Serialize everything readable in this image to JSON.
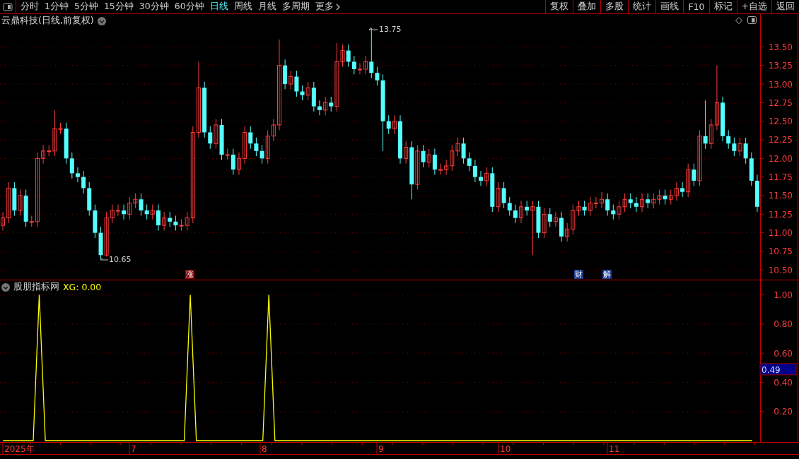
{
  "toolbar": {
    "tabs": [
      {
        "label": "分时",
        "selected": false
      },
      {
        "label": "1分钟",
        "selected": false
      },
      {
        "label": "5分钟",
        "selected": false
      },
      {
        "label": "15分钟",
        "selected": false
      },
      {
        "label": "30分钟",
        "selected": false
      },
      {
        "label": "60分钟",
        "selected": false
      },
      {
        "label": "日线",
        "selected": true
      },
      {
        "label": "周线",
        "selected": false
      },
      {
        "label": "月线",
        "selected": false
      },
      {
        "label": "多周期",
        "selected": false
      },
      {
        "label": "更多",
        "selected": false
      }
    ],
    "buttons": [
      "复权",
      "叠加",
      "多股",
      "统计",
      "画线",
      "F10",
      "标记",
      "+自选",
      "返回"
    ]
  },
  "main_chart": {
    "title": "云鼎科技(日线,前复权)",
    "high_label": "13.75",
    "low_label": "10.65",
    "markers": [
      {
        "label": "涨",
        "color": "#8c0000"
      },
      {
        "label": "财",
        "color": "#1c3a8e"
      },
      {
        "label": "解",
        "color": "#1c3a8e"
      }
    ],
    "chart_data": {
      "type": "candlestick",
      "ylim": [
        10.37,
        13.94
      ],
      "grid": true,
      "yticks": [
        {
          "value": 13.5,
          "label": "13.50"
        },
        {
          "value": 13.25,
          "label": "13.25"
        },
        {
          "value": 13,
          "label": "13.00"
        },
        {
          "value": 12.75,
          "label": "12.75"
        },
        {
          "value": 12.5,
          "label": "12.50"
        },
        {
          "value": 12.25,
          "label": "12.25"
        },
        {
          "value": 12,
          "label": "12.00"
        },
        {
          "value": 11.75,
          "label": "11.75"
        },
        {
          "value": 11.5,
          "label": "11.50"
        },
        {
          "value": 11.25,
          "label": "11.25"
        },
        {
          "value": 11,
          "label": "11.00"
        },
        {
          "value": 10.75,
          "label": "10.75"
        },
        {
          "value": 10.5,
          "label": "10.50"
        }
      ],
      "ohlc": [
        [
          11.1,
          11.28,
          11.03,
          11.2
        ],
        [
          11.2,
          11.68,
          11.13,
          11.6
        ],
        [
          11.6,
          11.68,
          11.23,
          11.3
        ],
        [
          11.3,
          11.58,
          11.23,
          11.5
        ],
        [
          11.5,
          11.58,
          11.08,
          11.15
        ],
        [
          11.15,
          11.23,
          11.08,
          11.15
        ],
        [
          11.15,
          12.08,
          11.08,
          12.0
        ],
        [
          12.0,
          12.18,
          11.93,
          12.1
        ],
        [
          12.1,
          12.18,
          12.03,
          12.1
        ],
        [
          12.1,
          12.65,
          12.03,
          12.4
        ],
        [
          12.4,
          12.48,
          12.33,
          12.4
        ],
        [
          12.4,
          12.48,
          11.93,
          12.0
        ],
        [
          12.0,
          12.08,
          11.73,
          11.8
        ],
        [
          11.8,
          11.88,
          11.68,
          11.75
        ],
        [
          11.75,
          11.83,
          11.53,
          11.6
        ],
        [
          11.6,
          11.68,
          11.23,
          11.3
        ],
        [
          11.3,
          11.38,
          10.93,
          11.0
        ],
        [
          11.0,
          11.08,
          10.65,
          10.7
        ],
        [
          10.7,
          11.28,
          10.68,
          11.2
        ],
        [
          11.2,
          11.38,
          11.13,
          11.3
        ],
        [
          11.3,
          11.38,
          11.23,
          11.3
        ],
        [
          11.3,
          11.38,
          11.18,
          11.25
        ],
        [
          11.25,
          11.48,
          11.18,
          11.4
        ],
        [
          11.4,
          11.53,
          11.33,
          11.45
        ],
        [
          11.45,
          11.53,
          11.23,
          11.3
        ],
        [
          11.3,
          11.38,
          11.18,
          11.25
        ],
        [
          11.25,
          11.38,
          11.18,
          11.3
        ],
        [
          11.3,
          11.38,
          11.03,
          11.1
        ],
        [
          11.1,
          11.28,
          11.03,
          11.2
        ],
        [
          11.2,
          11.28,
          11.08,
          11.15
        ],
        [
          11.15,
          11.23,
          11.03,
          11.1
        ],
        [
          11.1,
          11.18,
          11.03,
          11.1
        ],
        [
          11.1,
          11.28,
          11.03,
          11.2
        ],
        [
          11.2,
          12.43,
          11.13,
          12.35
        ],
        [
          12.35,
          13.3,
          12.28,
          12.95
        ],
        [
          12.95,
          13.03,
          12.28,
          12.35
        ],
        [
          12.35,
          12.43,
          12.13,
          12.2
        ],
        [
          12.2,
          12.53,
          12.13,
          12.45
        ],
        [
          12.45,
          12.53,
          11.98,
          12.05
        ],
        [
          12.05,
          12.13,
          11.98,
          12.05
        ],
        [
          12.05,
          12.13,
          11.78,
          11.85
        ],
        [
          11.85,
          12.08,
          11.78,
          12.0
        ],
        [
          12.0,
          12.43,
          11.93,
          12.35
        ],
        [
          12.35,
          12.43,
          12.13,
          12.2
        ],
        [
          12.2,
          12.28,
          12.03,
          12.1
        ],
        [
          12.1,
          12.18,
          11.93,
          12.0
        ],
        [
          12.0,
          12.38,
          11.93,
          12.3
        ],
        [
          12.3,
          12.53,
          12.23,
          12.45
        ],
        [
          12.45,
          13.6,
          12.38,
          13.25
        ],
        [
          13.25,
          13.33,
          12.93,
          13.0
        ],
        [
          13.0,
          13.18,
          12.93,
          13.1
        ],
        [
          13.1,
          13.18,
          12.83,
          12.9
        ],
        [
          12.9,
          12.98,
          12.78,
          12.85
        ],
        [
          12.85,
          13.03,
          12.78,
          12.95
        ],
        [
          12.95,
          13.03,
          12.63,
          12.7
        ],
        [
          12.7,
          12.78,
          12.58,
          12.65
        ],
        [
          12.65,
          12.83,
          12.58,
          12.75
        ],
        [
          12.75,
          12.83,
          12.63,
          12.7
        ],
        [
          12.7,
          13.55,
          12.63,
          13.3
        ],
        [
          13.3,
          13.53,
          13.23,
          13.45
        ],
        [
          13.45,
          13.53,
          13.23,
          13.3
        ],
        [
          13.3,
          13.38,
          13.13,
          13.2
        ],
        [
          13.2,
          13.28,
          13.13,
          13.2
        ],
        [
          13.2,
          13.38,
          13.13,
          13.3
        ],
        [
          13.3,
          13.75,
          13.08,
          13.15
        ],
        [
          13.15,
          13.23,
          12.98,
          13.05
        ],
        [
          13.05,
          13.13,
          12.1,
          12.5
        ],
        [
          12.5,
          12.58,
          12.33,
          12.4
        ],
        [
          12.4,
          12.58,
          12.33,
          12.5
        ],
        [
          12.5,
          12.58,
          11.93,
          12.0
        ],
        [
          12.0,
          12.23,
          11.93,
          12.15
        ],
        [
          12.15,
          12.23,
          11.45,
          11.65
        ],
        [
          11.65,
          12.18,
          11.58,
          12.1
        ],
        [
          12.1,
          12.18,
          11.88,
          11.95
        ],
        [
          11.95,
          12.13,
          11.88,
          12.05
        ],
        [
          12.05,
          12.13,
          11.78,
          11.85
        ],
        [
          11.85,
          11.93,
          11.78,
          11.85
        ],
        [
          11.85,
          11.98,
          11.78,
          11.9
        ],
        [
          11.9,
          12.18,
          11.83,
          12.1
        ],
        [
          12.1,
          12.28,
          12.03,
          12.2
        ],
        [
          12.2,
          12.28,
          11.93,
          12.0
        ],
        [
          12.0,
          12.08,
          11.83,
          11.9
        ],
        [
          11.9,
          11.98,
          11.68,
          11.75
        ],
        [
          11.75,
          11.83,
          11.63,
          11.7
        ],
        [
          11.7,
          11.88,
          11.63,
          11.8
        ],
        [
          11.8,
          11.88,
          11.28,
          11.35
        ],
        [
          11.35,
          11.68,
          11.28,
          11.6
        ],
        [
          11.6,
          11.68,
          11.33,
          11.4
        ],
        [
          11.4,
          11.48,
          11.23,
          11.3
        ],
        [
          11.3,
          11.38,
          11.13,
          11.2
        ],
        [
          11.2,
          11.43,
          11.13,
          11.35
        ],
        [
          11.35,
          11.43,
          11.23,
          11.3
        ],
        [
          11.3,
          11.43,
          10.7,
          11.35
        ],
        [
          11.35,
          11.43,
          10.93,
          11.0
        ],
        [
          11.0,
          11.33,
          10.93,
          11.25
        ],
        [
          11.25,
          11.33,
          11.08,
          11.15
        ],
        [
          11.15,
          11.28,
          11.08,
          11.2
        ],
        [
          11.2,
          11.28,
          10.88,
          10.95
        ],
        [
          10.95,
          11.13,
          10.88,
          11.05
        ],
        [
          11.05,
          11.38,
          10.98,
          11.3
        ],
        [
          11.3,
          11.43,
          11.23,
          11.35
        ],
        [
          11.35,
          11.43,
          11.23,
          11.3
        ],
        [
          11.3,
          11.48,
          11.23,
          11.4
        ],
        [
          11.4,
          11.48,
          11.33,
          11.4
        ],
        [
          11.4,
          11.55,
          11.33,
          11.45
        ],
        [
          11.45,
          11.53,
          11.23,
          11.3
        ],
        [
          11.3,
          11.38,
          11.18,
          11.25
        ],
        [
          11.25,
          11.43,
          11.18,
          11.35
        ],
        [
          11.35,
          11.53,
          11.28,
          11.45
        ],
        [
          11.45,
          11.53,
          11.33,
          11.4
        ],
        [
          11.4,
          11.48,
          11.28,
          11.35
        ],
        [
          11.35,
          11.53,
          11.28,
          11.45
        ],
        [
          11.45,
          11.53,
          11.33,
          11.4
        ],
        [
          11.4,
          11.53,
          11.33,
          11.45
        ],
        [
          11.45,
          11.58,
          11.38,
          11.5
        ],
        [
          11.5,
          11.58,
          11.38,
          11.45
        ],
        [
          11.45,
          11.58,
          11.38,
          11.5
        ],
        [
          11.5,
          11.68,
          11.43,
          11.6
        ],
        [
          11.6,
          11.68,
          11.48,
          11.55
        ],
        [
          11.55,
          11.93,
          11.48,
          11.85
        ],
        [
          11.85,
          11.93,
          11.63,
          11.7
        ],
        [
          11.7,
          12.38,
          11.63,
          12.3
        ],
        [
          12.3,
          12.78,
          12.13,
          12.2
        ],
        [
          12.2,
          12.53,
          12.13,
          12.45
        ],
        [
          12.45,
          13.25,
          12.38,
          12.75
        ],
        [
          12.75,
          12.83,
          12.23,
          12.3
        ],
        [
          12.3,
          12.38,
          12.13,
          12.2
        ],
        [
          12.2,
          12.28,
          12.03,
          12.1
        ],
        [
          12.1,
          12.28,
          12.03,
          12.2
        ],
        [
          12.2,
          12.28,
          11.93,
          12.0
        ],
        [
          12.0,
          12.08,
          11.63,
          11.7
        ],
        [
          11.7,
          11.78,
          11.28,
          11.35
        ]
      ]
    }
  },
  "indicator": {
    "title": "股朋指标网",
    "value_text": ": 0.00",
    "cursor_value": "0.49",
    "chart_data": {
      "type": "line",
      "ylim": [
        0,
        1.1
      ],
      "grid": true,
      "yticks": [
        {
          "value": 0.2,
          "label": "0.20"
        },
        {
          "value": 0.4,
          "label": "0.40"
        },
        {
          "value": 0.6,
          "label": "0.60"
        },
        {
          "value": 0.8,
          "label": "0.80"
        },
        {
          "value": 1,
          "label": "1.00"
        }
      ],
      "series": [
        {
          "name": "XG",
          "color": "#ffff00",
          "values": [
            0,
            0,
            0,
            0,
            0,
            0,
            1,
            0,
            0,
            0,
            0,
            0,
            0,
            0,
            0,
            0,
            0,
            0,
            0,
            0,
            0,
            0,
            0,
            0,
            0,
            0,
            0,
            0,
            0,
            0,
            0,
            1,
            0,
            0,
            0,
            0,
            0,
            0,
            0,
            0,
            0,
            0,
            0,
            0,
            1,
            0,
            0,
            0,
            0,
            0,
            0,
            0,
            0,
            0,
            0,
            0,
            0,
            0,
            0,
            0,
            0,
            0,
            0,
            0,
            0,
            0,
            0,
            0,
            0,
            0,
            0,
            0,
            0,
            0,
            0,
            0,
            0,
            0,
            0,
            0,
            0,
            0,
            0,
            0,
            0,
            0,
            0,
            0,
            0,
            0,
            0,
            0,
            0,
            0,
            0,
            0,
            0,
            0,
            0,
            0,
            0,
            0,
            0,
            0,
            0,
            0,
            0,
            0,
            0,
            0,
            0,
            0,
            0,
            0,
            0,
            0,
            0,
            0,
            0,
            0,
            0,
            0,
            0,
            0,
            0
          ]
        }
      ]
    },
    "date_axis": [
      "2025年",
      "7",
      "8",
      "9",
      "10",
      "11"
    ]
  }
}
